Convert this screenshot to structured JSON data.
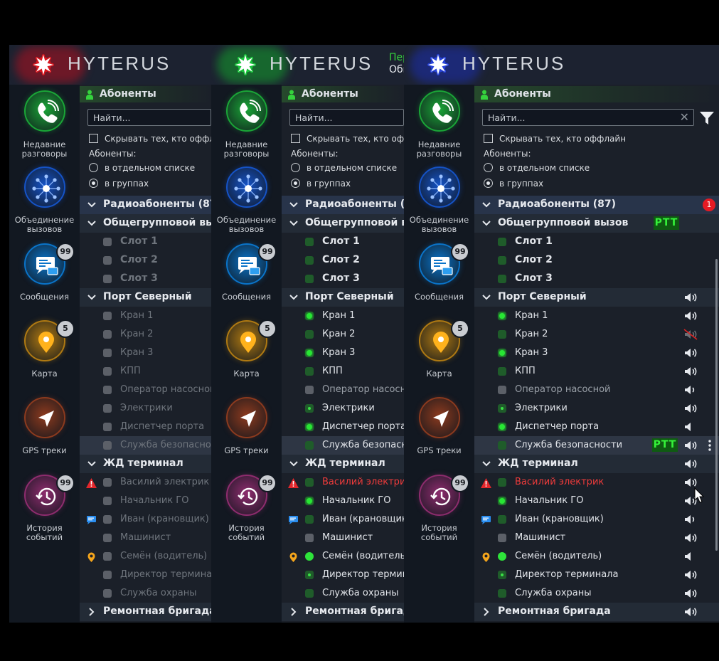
{
  "app": {
    "brand": "HYTERUS"
  },
  "header_snippet": {
    "line1": "Пер",
    "line2": "Общ"
  },
  "themes": [
    {
      "id": "red",
      "accent": "#d7161e",
      "glow": "#b01020"
    },
    {
      "id": "green",
      "accent": "#18c23a",
      "glow": "#13a12d"
    },
    {
      "id": "blue",
      "accent": "#2742d8",
      "glow": "#1c2fb0"
    }
  ],
  "sidebar": {
    "items": [
      {
        "label1": "Недавние",
        "label2": "разговоры",
        "icon": "phone-icon",
        "color": "#1aa637"
      },
      {
        "label1": "Объединение",
        "label2": "вызовов",
        "icon": "network-icon",
        "color": "#1553c7"
      },
      {
        "label1": "Сообщения",
        "label2": "",
        "icon": "message-icon",
        "color": "#0a74c9",
        "badge": "99"
      },
      {
        "label1": "Карта",
        "label2": "",
        "icon": "map-pin-icon",
        "color": "#b07a12",
        "badge": "5"
      },
      {
        "label1": "GPS треки",
        "label2": "",
        "icon": "navigation-arrow-icon",
        "color": "#8c3a1e"
      },
      {
        "label1": "История",
        "label2": "событий",
        "icon": "history-clock-icon",
        "color": "#8e2c6e",
        "badge": "99"
      }
    ]
  },
  "subscribers": {
    "title": "Абоненты",
    "search_placeholder": "Найти...",
    "hide_offline": "Скрывать тех, кто оффлайн",
    "view_label": "Абоненты:",
    "view_options": [
      "в отдельном списке",
      "в группах"
    ],
    "selected_view": "в группах"
  },
  "tree": {
    "root": {
      "label": "Радиоабоненты (87)",
      "alert_count": "1"
    },
    "ptt_label": "PTT",
    "groups": [
      {
        "name": "Общегрупповой вызов",
        "ptt": true,
        "members": [
          {
            "name": "Слот 1",
            "bold": true
          },
          {
            "name": "Слот 2",
            "bold": true
          },
          {
            "name": "Слот 3",
            "bold": true
          }
        ]
      },
      {
        "name": "Порт Северный",
        "speaker": "on",
        "members": [
          {
            "name": "Кран 1",
            "status": "online",
            "speaker": "on"
          },
          {
            "name": "Кран 2",
            "status": "offline-green",
            "speaker": "muted"
          },
          {
            "name": "Кран 3",
            "status": "online",
            "speaker": "on"
          },
          {
            "name": "КПП",
            "status": "offline-green",
            "speaker": "on"
          },
          {
            "name": "Оператор насосной",
            "status": "grey",
            "speaker": "low",
            "dim": true
          },
          {
            "name": "Электрики",
            "status": "small",
            "speaker": "on"
          },
          {
            "name": "Диспетчер порта",
            "status": "online",
            "speaker": "off"
          },
          {
            "name": "Служба безопасности",
            "status": "offline-green",
            "speaker": "on",
            "ptt": true,
            "selected": true
          }
        ]
      },
      {
        "name": "ЖД терминал",
        "speaker": "on",
        "members": [
          {
            "name": "Василий электрик",
            "status": "offline-green",
            "speaker": "on",
            "alert": true,
            "type_icon": "warning-icon"
          },
          {
            "name": "Начальник ГО",
            "status": "online",
            "speaker": "on"
          },
          {
            "name": "Иван (крановщик)",
            "status": "offline-green",
            "speaker": "low",
            "type_icon": "message-icon"
          },
          {
            "name": "Машинист",
            "status": "grey",
            "speaker": "on"
          },
          {
            "name": "Семён (водитель)",
            "status": "bright",
            "speaker": "off",
            "type_icon": "location-icon"
          },
          {
            "name": "Директор терминала",
            "status": "small",
            "speaker": "on"
          },
          {
            "name": "Служба охраны",
            "status": "offline-green",
            "speaker": "on"
          }
        ]
      },
      {
        "name": "Ремонтная бригада",
        "speaker": "on",
        "collapsed": true,
        "members": []
      }
    ]
  }
}
